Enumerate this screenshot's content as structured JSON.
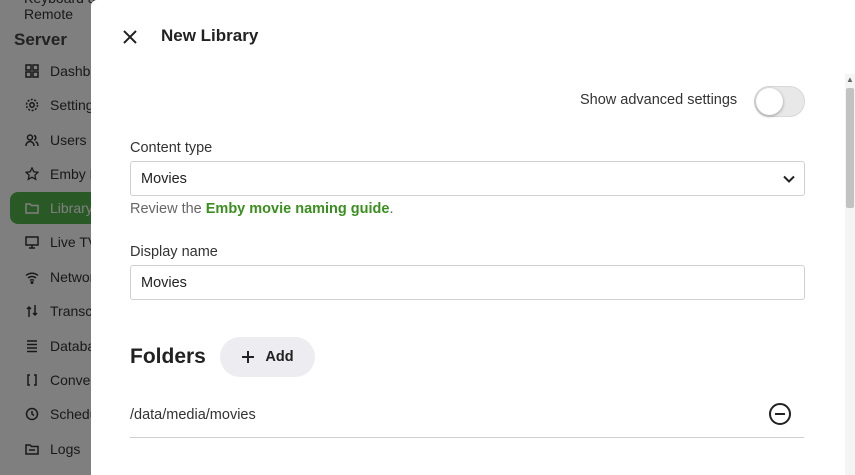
{
  "sidebar": {
    "top_item": "Keyboard and Remote",
    "section_title": "Server",
    "items": [
      {
        "label": "Dashboard",
        "icon": "dashboard-icon"
      },
      {
        "label": "Settings",
        "icon": "gear-icon"
      },
      {
        "label": "Users",
        "icon": "users-icon"
      },
      {
        "label": "Emby Premiere",
        "icon": "star-icon"
      },
      {
        "label": "Library",
        "icon": "folder-icon",
        "active": true
      },
      {
        "label": "Live TV",
        "icon": "tv-icon"
      },
      {
        "label": "Network",
        "icon": "wifi-icon"
      },
      {
        "label": "Transcoding",
        "icon": "transcode-icon"
      },
      {
        "label": "Database",
        "icon": "database-icon"
      },
      {
        "label": "Conversions",
        "icon": "convert-icon"
      },
      {
        "label": "Scheduled Tasks",
        "icon": "clock-icon"
      },
      {
        "label": "Logs",
        "icon": "logs-folder-icon"
      }
    ]
  },
  "dialog": {
    "title": "New Library",
    "advanced_settings_label": "Show advanced settings",
    "advanced_settings_enabled": false,
    "content_type": {
      "label": "Content type",
      "value": "Movies"
    },
    "helper": {
      "prefix": "Review the ",
      "link": "Emby movie naming guide",
      "suffix": "."
    },
    "display_name": {
      "label": "Display name",
      "value": "Movies"
    },
    "folders": {
      "title": "Folders",
      "add_label": "Add",
      "items": [
        "/data/media/movies"
      ]
    }
  },
  "colors": {
    "accent": "#52b54b",
    "link": "#3a8f1f"
  }
}
